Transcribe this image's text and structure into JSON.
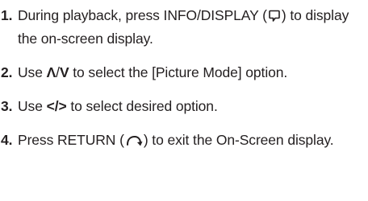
{
  "steps": [
    {
      "number": "1.",
      "before": "During playback, press INFO/DISPLAY (",
      "icon": "info-display-icon",
      "after": ") to display the on-screen display."
    },
    {
      "number": "2.",
      "before": "Use ",
      "symbol_up": "Λ",
      "slash": "/",
      "symbol_down": "V",
      "after": " to select the [Picture Mode] option."
    },
    {
      "number": "3.",
      "before": "Use ",
      "symbol": "</>",
      "after": " to select desired option."
    },
    {
      "number": "4.",
      "before": "Press RETURN (",
      "icon": "return-arrow-icon",
      "after": ") to exit the On-Screen display."
    }
  ]
}
